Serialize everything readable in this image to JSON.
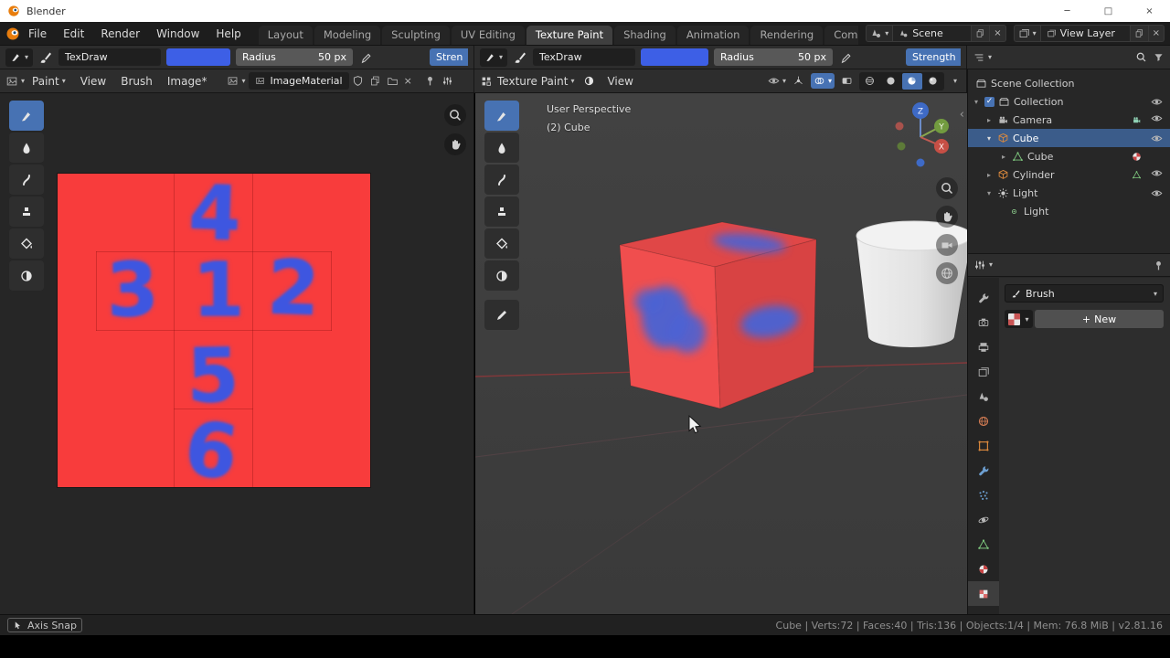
{
  "colors": {
    "accent_blue": "#4772b3",
    "canvas_red": "#f83c3c",
    "paint_blue": "#3e56e0",
    "selection_blue": "#3b5c8a"
  },
  "icons": {
    "chevron_down": "▾",
    "chevron_right": "▸",
    "check": "✓",
    "close": "×",
    "minimize": "─",
    "maximize": "□",
    "plus": "+",
    "collapse_left": "‹"
  },
  "titlebar": {
    "app_name": "Blender"
  },
  "menubar": {
    "items": [
      "File",
      "Edit",
      "Render",
      "Window",
      "Help"
    ]
  },
  "workspaces": [
    "Layout",
    "Modeling",
    "Sculpting",
    "UV Editing",
    "Texture Paint",
    "Shading",
    "Animation",
    "Rendering",
    "Compos"
  ],
  "scene_selector": {
    "label": "Scene"
  },
  "view_layer_selector": {
    "label": "View Layer"
  },
  "image_tool_settings": {
    "brush_name": "TexDraw",
    "radius_label": "Radius",
    "radius_value": "50 px",
    "strength_label": "Stren"
  },
  "viewport_tool_settings": {
    "brush_name": "TexDraw",
    "radius_label": "Radius",
    "radius_value": "50 px",
    "strength_label": "Strength"
  },
  "image_editor": {
    "menus": {
      "paint": "Paint",
      "view": "View",
      "brush": "Brush",
      "image": "Image*"
    },
    "image_name": "ImageMaterial",
    "numbers": [
      "4",
      "3",
      "1",
      "2",
      "5",
      "6"
    ]
  },
  "viewport": {
    "mode": "Texture Paint",
    "view_menu": "View",
    "overlay": {
      "line1": "User Perspective",
      "line2": "(2) Cube"
    },
    "gizmo_axes": {
      "x": "X",
      "y": "Y",
      "z": "Z"
    }
  },
  "outliner": {
    "rows": [
      {
        "label": "Scene Collection"
      },
      {
        "label": "Collection"
      },
      {
        "label": "Camera"
      },
      {
        "label": "Cube"
      },
      {
        "label": "Cube"
      },
      {
        "label": "Cylinder"
      },
      {
        "label": "Light"
      },
      {
        "label": "Light"
      }
    ]
  },
  "properties": {
    "context_label": "Brush",
    "new_button": "New"
  },
  "statusbar": {
    "left": "Axis Snap",
    "right": "Cube | Verts:72 | Faces:40 | Tris:136 | Objects:1/4 | Mem: 76.8 MiB | v2.81.16"
  }
}
